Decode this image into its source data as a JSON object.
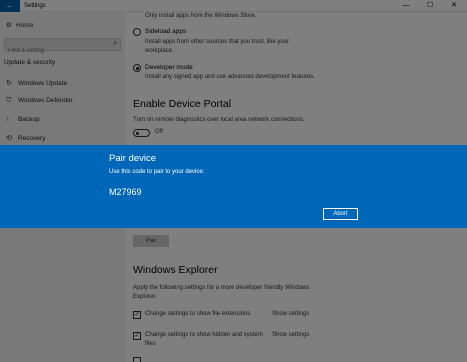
{
  "window": {
    "title": "Settings",
    "back_icon": "back-arrow-icon",
    "minimize_glyph": "—",
    "maximize_glyph": "☐",
    "close_glyph": "✕"
  },
  "sidebar": {
    "home_label": "Home",
    "search_placeholder": "Find a setting",
    "section_title": "Update & security",
    "items": [
      {
        "label": "Windows Update",
        "icon": "refresh-icon"
      },
      {
        "label": "Windows Defender",
        "icon": "shield-icon"
      },
      {
        "label": "Backup",
        "icon": "backup-icon"
      },
      {
        "label": "Recovery",
        "icon": "recovery-icon"
      }
    ]
  },
  "main": {
    "store_desc": "Only install apps from the Windows Store.",
    "sideload_label": "Sideload apps",
    "sideload_desc_1": "Install apps from other sources that you trust, like your",
    "sideload_desc_2": "workplace.",
    "devmode_label": "Developer mode",
    "devmode_desc": "Install any signed app and use advanced development features.",
    "selected_option": "Developer mode",
    "portal_heading": "Enable Device Portal",
    "portal_desc": "Turn on remote diagnostics over local area network connections.",
    "portal_toggle": "Off",
    "pair_button": "Pair",
    "explorer_heading": "Windows Explorer",
    "explorer_desc_1": "Apply the following settings for a more developer friendly Windows",
    "explorer_desc_2": "Explorer.",
    "checks": [
      {
        "label": "Change settings to show file extensions",
        "link": "Show settings",
        "checked": true
      },
      {
        "label_1": "Change settings to show hidden and system",
        "label_2": "files",
        "link": "Show settings",
        "checked": true
      }
    ]
  },
  "dialog": {
    "title": "Pair device",
    "subtitle": "Use this code to pair to your device:",
    "code": "M27969",
    "abort_label": "Abort",
    "accent": "#0067b8"
  }
}
